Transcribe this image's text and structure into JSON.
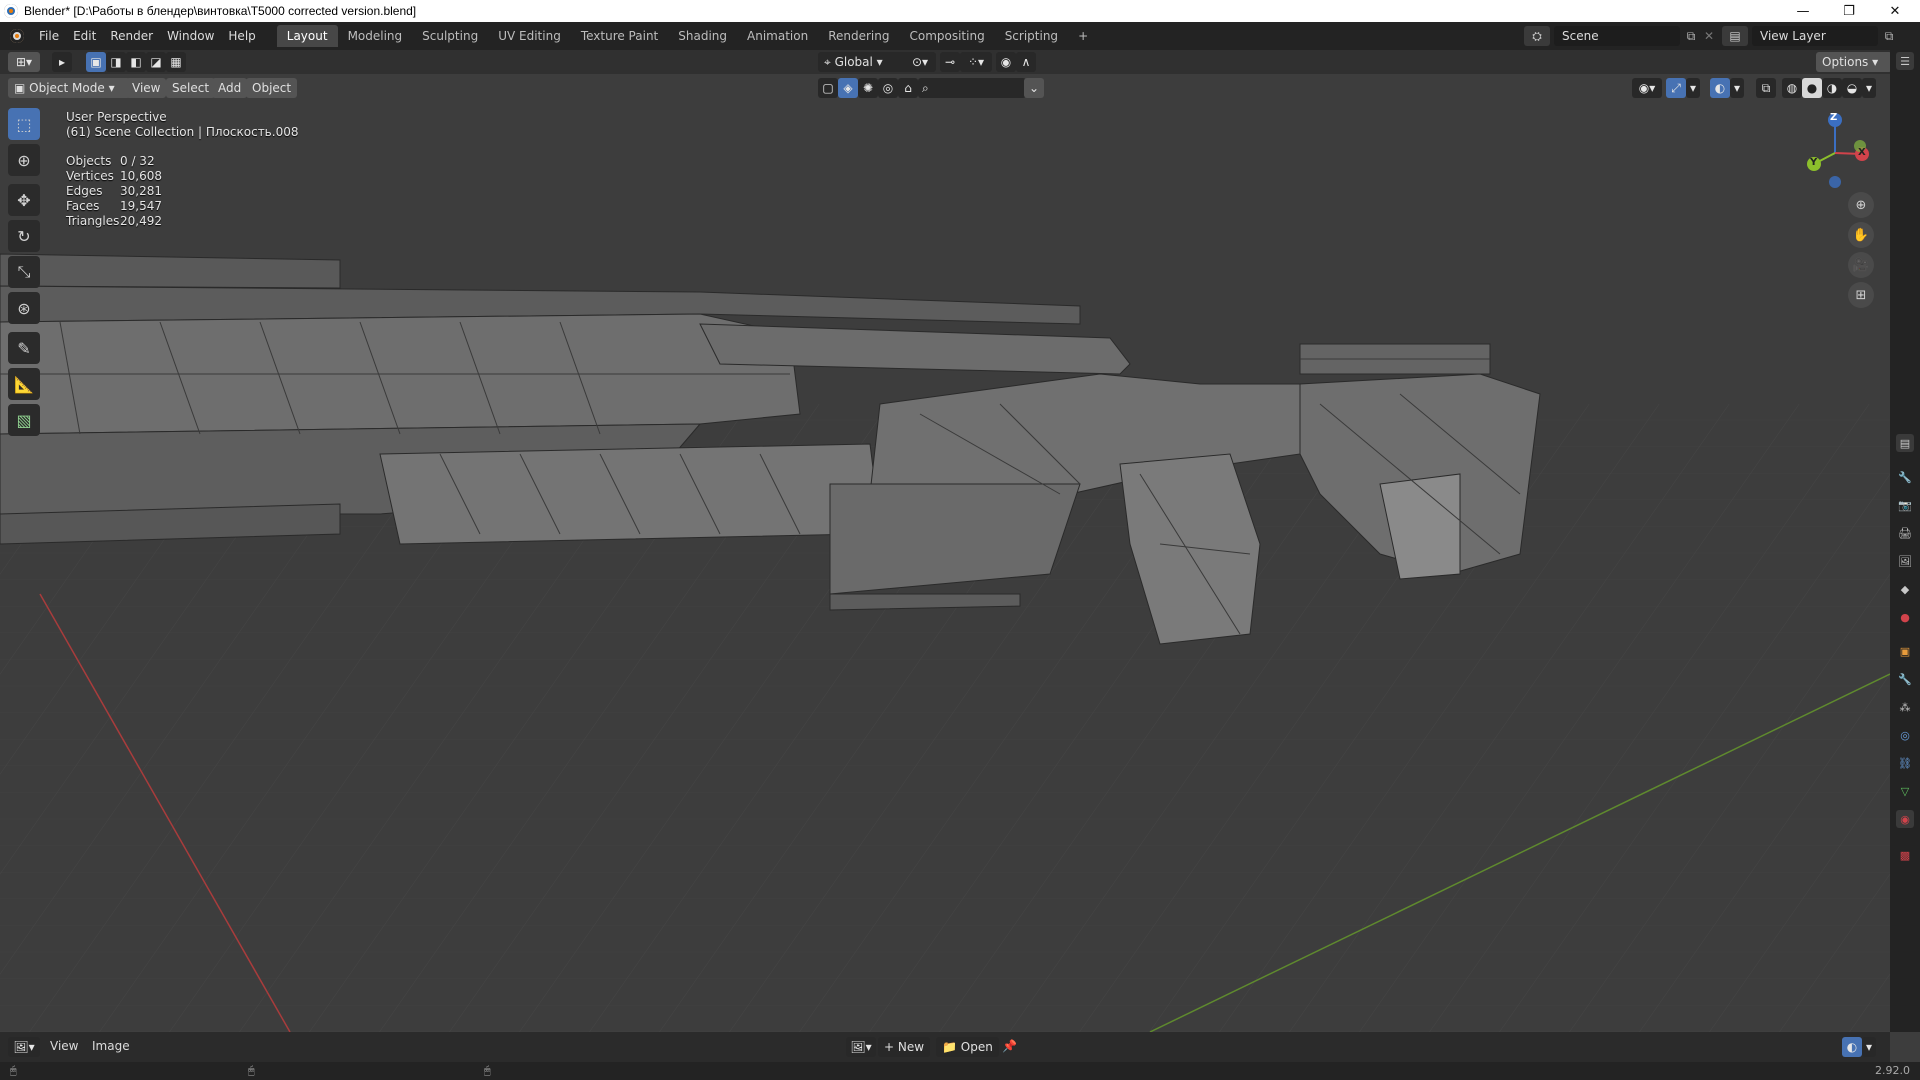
{
  "window": {
    "title": "Blender* [D:\\Работы в блендер\\винтовка\\T5000 corrected version.blend]",
    "controls": [
      "—",
      "❐",
      "✕"
    ]
  },
  "menus": [
    "File",
    "Edit",
    "Render",
    "Window",
    "Help"
  ],
  "workspaces": [
    "Layout",
    "Modeling",
    "Sculpting",
    "UV Editing",
    "Texture Paint",
    "Shading",
    "Animation",
    "Rendering",
    "Compositing",
    "Scripting"
  ],
  "add_workspace": "+",
  "scene": {
    "name": "Scene"
  },
  "view_layer": {
    "name": "View Layer"
  },
  "header": {
    "transform_orientation": "Global",
    "options_label": "Options",
    "mode": "Object Mode",
    "view": "View",
    "select": "Select",
    "add": "Add",
    "object": "Object"
  },
  "viewport": {
    "perspective": "User Perspective",
    "collection": "(61) Scene Collection | Плоскость.008",
    "stats": [
      {
        "label": "Objects",
        "value": "0 / 32"
      },
      {
        "label": "Vertices",
        "value": "10,608"
      },
      {
        "label": "Edges",
        "value": "30,281"
      },
      {
        "label": "Faces",
        "value": "19,547"
      },
      {
        "label": "Triangles",
        "value": "20,492"
      }
    ],
    "gizmo": {
      "x": "X",
      "y": "Y",
      "z": "Z"
    },
    "colors": {
      "background": "#3d3d3d",
      "grid": "#4a4a4a",
      "x_axis": "#a83c3c",
      "y_axis": "#5f8a2e",
      "accent": "#4772b3"
    }
  },
  "bottom_editor": {
    "view": "View",
    "image": "Image",
    "new": "New",
    "open": "Open"
  },
  "status": {
    "version": "2.92.0"
  }
}
